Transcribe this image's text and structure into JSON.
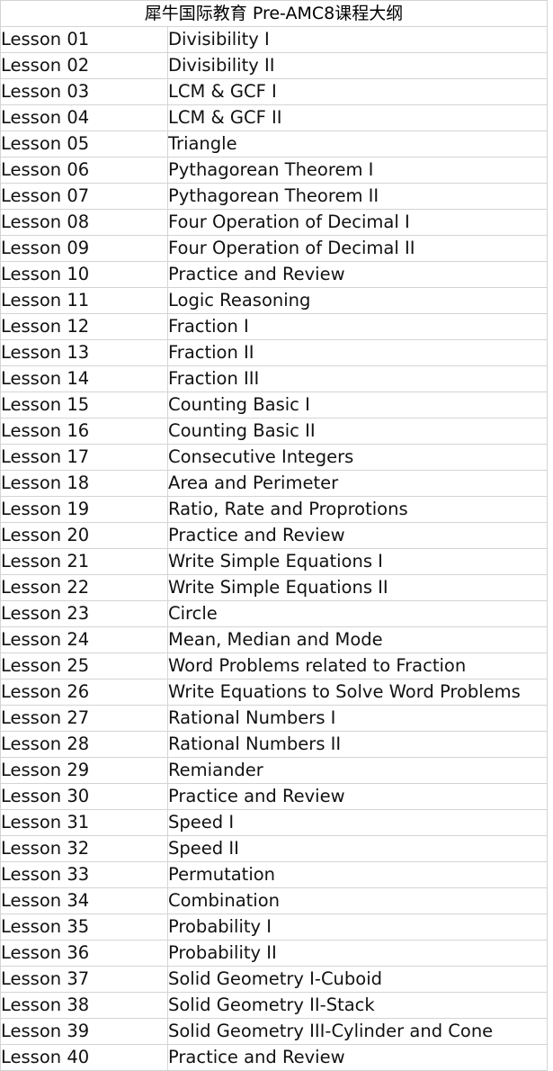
{
  "document": {
    "title": "犀牛国际教育 Pre-AMC8课程大纲",
    "border_color": "#d4d4d4",
    "text_color": "#111111",
    "background": "#ffffff"
  },
  "table": {
    "columns": [
      "lesson",
      "topic"
    ],
    "rows": [
      {
        "lesson": "Lesson 01",
        "topic": "Divisibility I"
      },
      {
        "lesson": "Lesson 02",
        "topic": "Divisibility II"
      },
      {
        "lesson": "Lesson 03",
        "topic": "LCM & GCF I"
      },
      {
        "lesson": "Lesson 04",
        "topic": "LCM & GCF II"
      },
      {
        "lesson": "Lesson 05",
        "topic": "Triangle"
      },
      {
        "lesson": "Lesson 06",
        "topic": "Pythagorean Theorem I"
      },
      {
        "lesson": "Lesson 07",
        "topic": "Pythagorean Theorem II"
      },
      {
        "lesson": "Lesson 08",
        "topic": "Four Operation of Decimal I"
      },
      {
        "lesson": "Lesson 09",
        "topic": "Four Operation of Decimal II"
      },
      {
        "lesson": "Lesson 10",
        "topic": "Practice and Review"
      },
      {
        "lesson": "Lesson 11",
        "topic": "Logic Reasoning"
      },
      {
        "lesson": "Lesson 12",
        "topic": "Fraction I"
      },
      {
        "lesson": "Lesson 13",
        "topic": "Fraction II"
      },
      {
        "lesson": "Lesson 14",
        "topic": "Fraction III"
      },
      {
        "lesson": "Lesson 15",
        "topic": "Counting Basic I"
      },
      {
        "lesson": "Lesson 16",
        "topic": "Counting Basic II"
      },
      {
        "lesson": "Lesson 17",
        "topic": "Consecutive Integers"
      },
      {
        "lesson": "Lesson 18",
        "topic": "Area and Perimeter"
      },
      {
        "lesson": "Lesson 19",
        "topic": "Ratio, Rate and Proprotions"
      },
      {
        "lesson": "Lesson 20",
        "topic": "Practice and Review"
      },
      {
        "lesson": "Lesson 21",
        "topic": "Write Simple Equations I"
      },
      {
        "lesson": "Lesson 22",
        "topic": "Write Simple Equations II"
      },
      {
        "lesson": "Lesson 23",
        "topic": "Circle"
      },
      {
        "lesson": "Lesson 24",
        "topic": "Mean, Median and Mode"
      },
      {
        "lesson": "Lesson 25",
        "topic": "Word Problems related to Fraction"
      },
      {
        "lesson": "Lesson 26",
        "topic": "Write Equations to Solve Word Problems"
      },
      {
        "lesson": "Lesson 27",
        "topic": "Rational Numbers I"
      },
      {
        "lesson": "Lesson 28",
        "topic": "Rational Numbers II"
      },
      {
        "lesson": "Lesson 29",
        "topic": "Remiander"
      },
      {
        "lesson": "Lesson 30",
        "topic": "Practice and Review"
      },
      {
        "lesson": "Lesson 31",
        "topic": "Speed I"
      },
      {
        "lesson": "Lesson 32",
        "topic": "Speed II"
      },
      {
        "lesson": "Lesson 33",
        "topic": "Permutation"
      },
      {
        "lesson": "Lesson 34",
        "topic": "Combination"
      },
      {
        "lesson": "Lesson 35",
        "topic": "Probability I"
      },
      {
        "lesson": "Lesson 36",
        "topic": "Probability II"
      },
      {
        "lesson": "Lesson 37",
        "topic": "Solid Geometry I-Cuboid"
      },
      {
        "lesson": "Lesson 38",
        "topic": "Solid Geometry II-Stack"
      },
      {
        "lesson": "Lesson 39",
        "topic": "Solid Geometry III-Cylinder and Cone"
      },
      {
        "lesson": "Lesson 40",
        "topic": "Practice and Review"
      }
    ]
  }
}
